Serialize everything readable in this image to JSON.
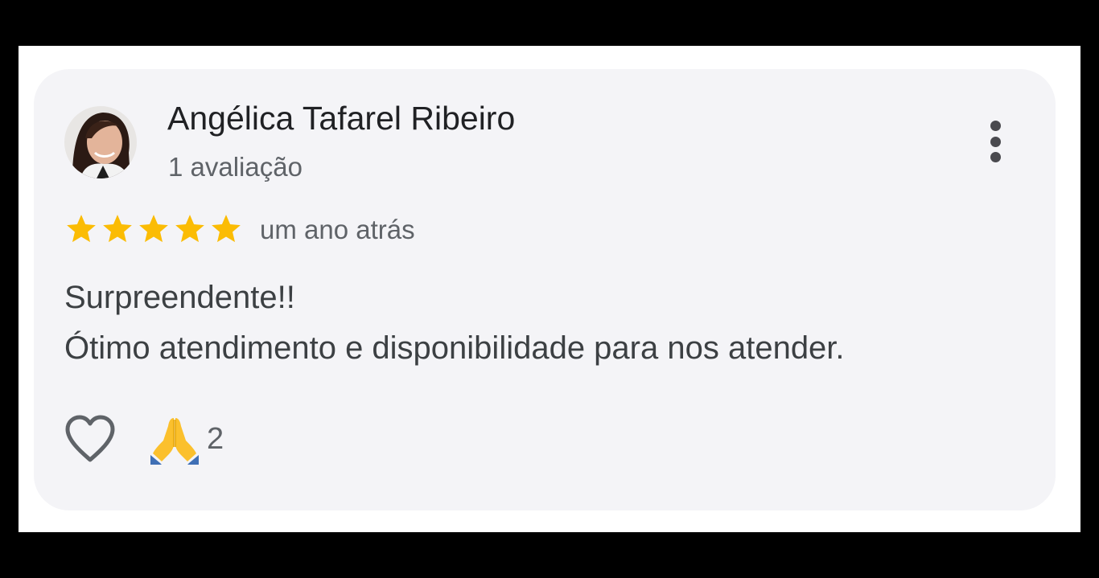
{
  "review": {
    "author_name": "Angélica Tafarel Ribeiro",
    "author_review_count": "1 avaliação",
    "rating": 5,
    "rating_max": 5,
    "time_ago": "um ano atrás",
    "text_line1": "Surpreendente!!",
    "text_line2": "Ótimo atendimento e disponibilidade para nos atender.",
    "reaction_emoji": "folded-hands",
    "reaction_count": "2"
  },
  "icons": {
    "avatar": "avatar",
    "more": "more-vert-icon",
    "star": "star-icon",
    "like": "heart-outline-icon",
    "reaction": "folded-hands-icon"
  },
  "colors": {
    "star": "#fbbc04",
    "card_background": "#f4f4f7",
    "name_text": "#202124",
    "secondary_text": "#5f6368"
  }
}
